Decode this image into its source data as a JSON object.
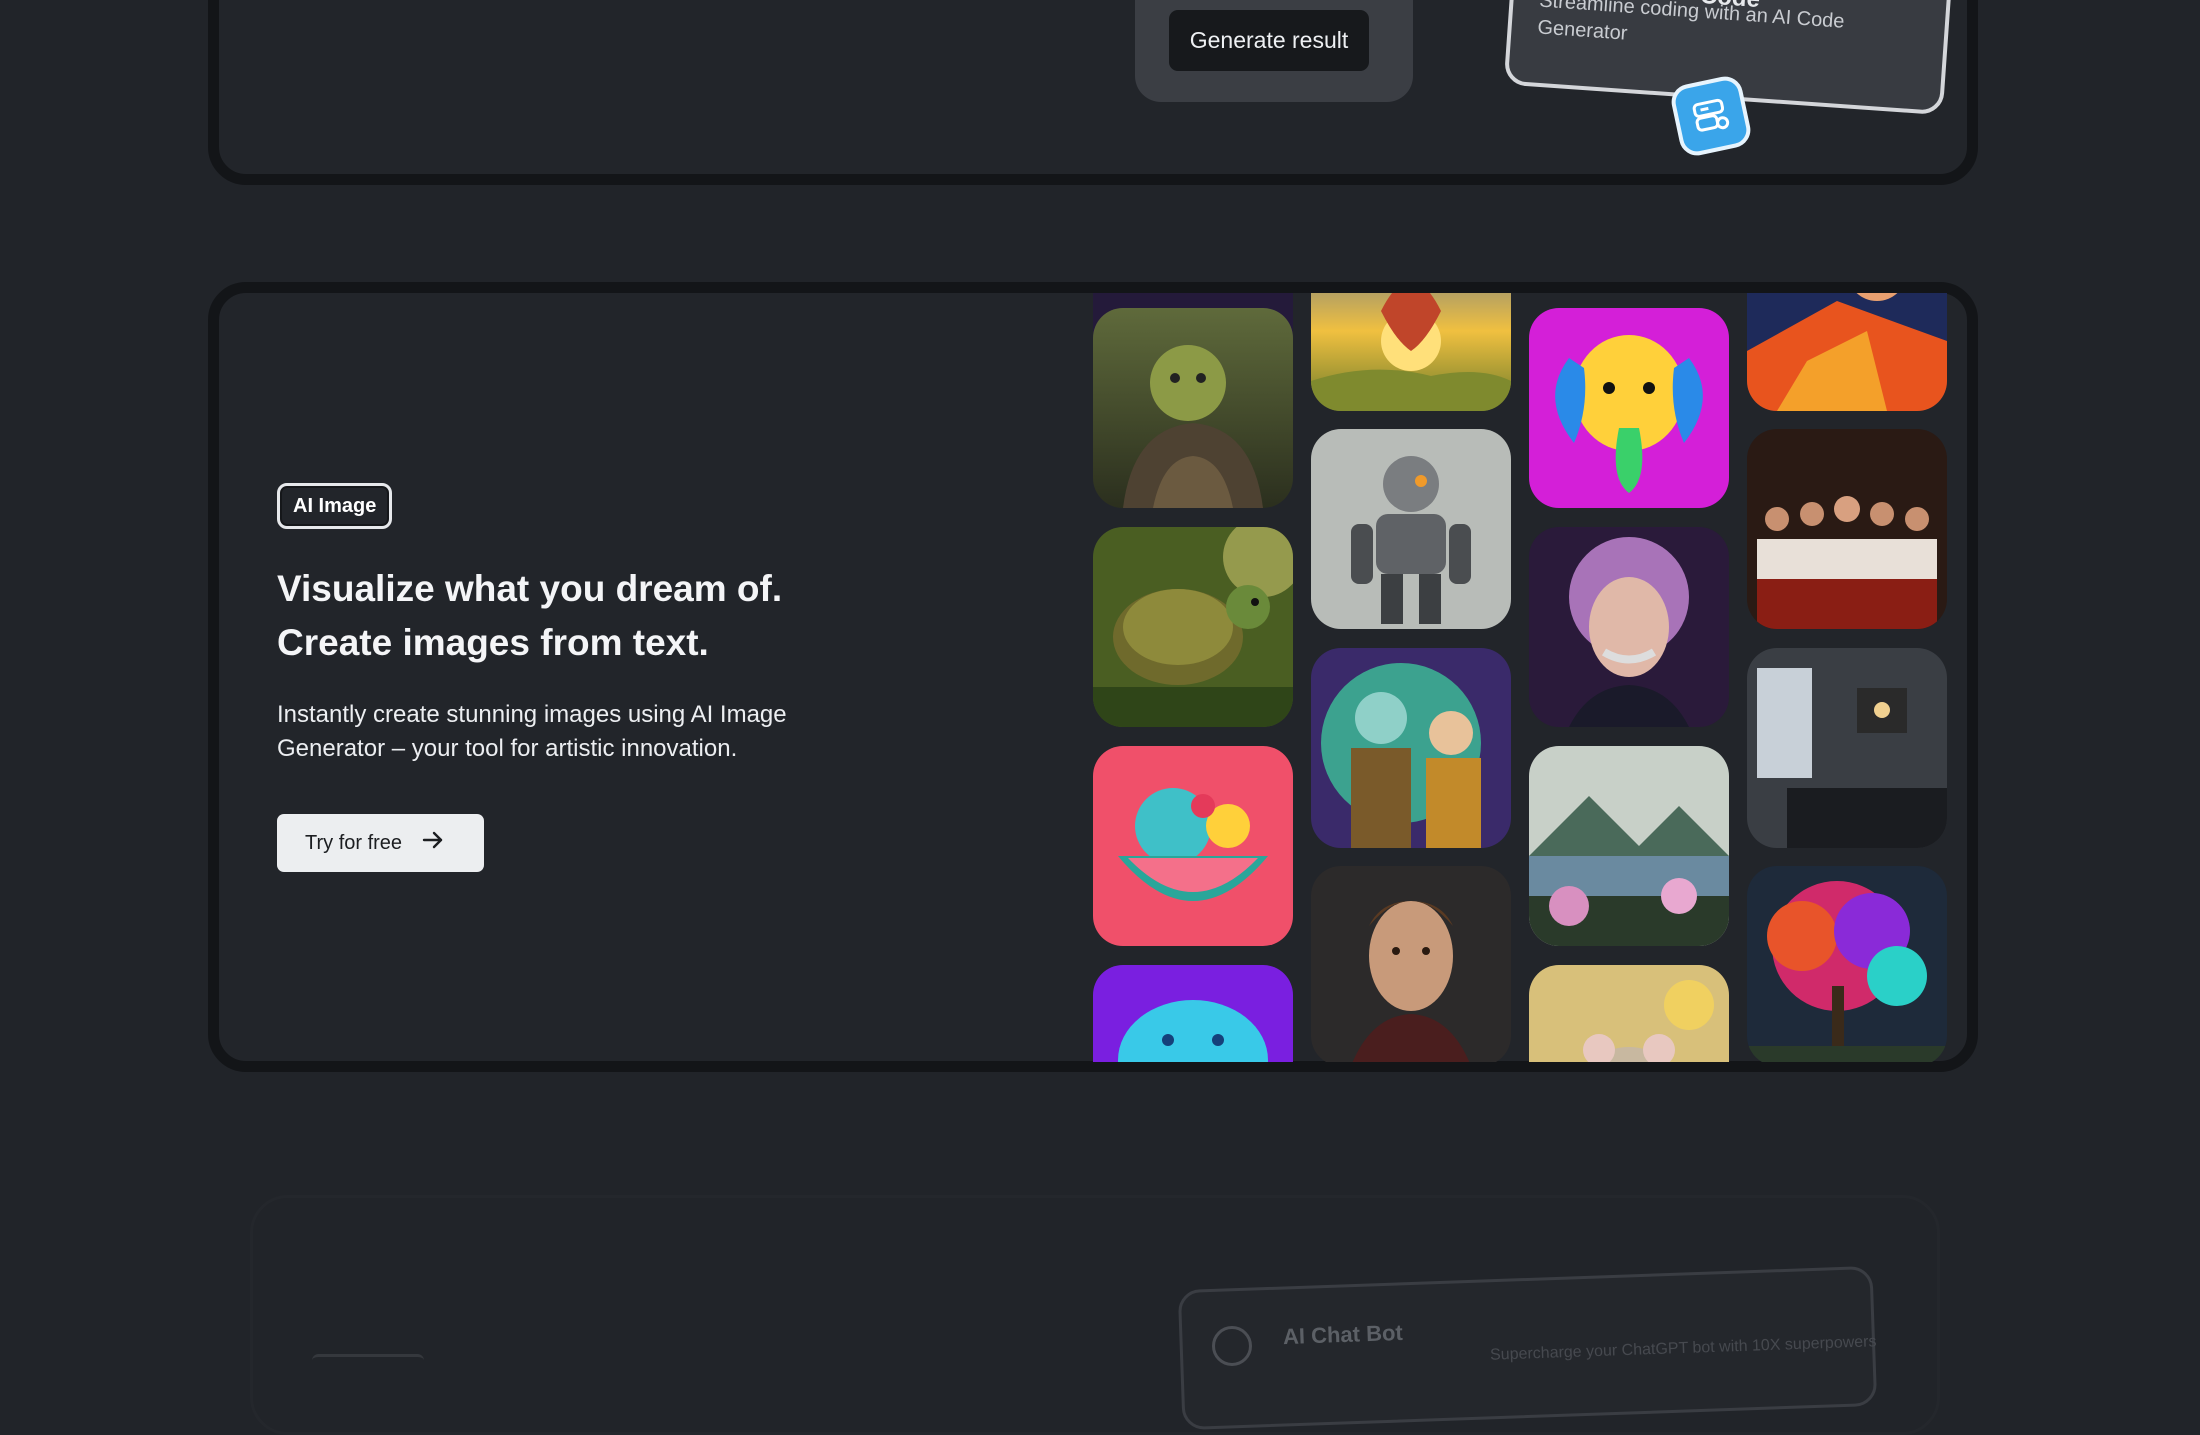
{
  "top_section": {
    "generate_button": "Generate result",
    "code_card": {
      "title": "Code",
      "description": "Streamline coding with an AI Code Generator",
      "icon": "server-settings-icon"
    }
  },
  "feature": {
    "tag": "AI Image",
    "headline_line1": "Visualize what you dream of.",
    "headline_line2": "Create images from text.",
    "description": "Instantly create stunning images using AI Image Generator – your tool for artistic innovation.",
    "cta_label": "Try for free",
    "cta_icon": "arrow-right-icon"
  },
  "gallery": {
    "images": [
      "ogre-warrior-image",
      "tortoise-image",
      "fruit-bowl-image",
      "blue-snake-image",
      "hot-air-balloon-image",
      "robot-image",
      "cartoon-scientists-image",
      "man-portrait-image",
      "colorful-elephant-image",
      "einstein-portrait-image",
      "mountain-lake-image",
      "mouse-image",
      "superhero-image",
      "last-supper-image",
      "bedroom-image",
      "rainbow-tree-image"
    ]
  },
  "bottom_section": {
    "chat_card_title": "AI Chat Bot",
    "chat_card_description": "Supercharge your ChatGPT bot with 10X superpowers"
  },
  "colors": {
    "background": "#212429",
    "card_border": "#131518",
    "accent_blue": "#3aa5ea"
  }
}
